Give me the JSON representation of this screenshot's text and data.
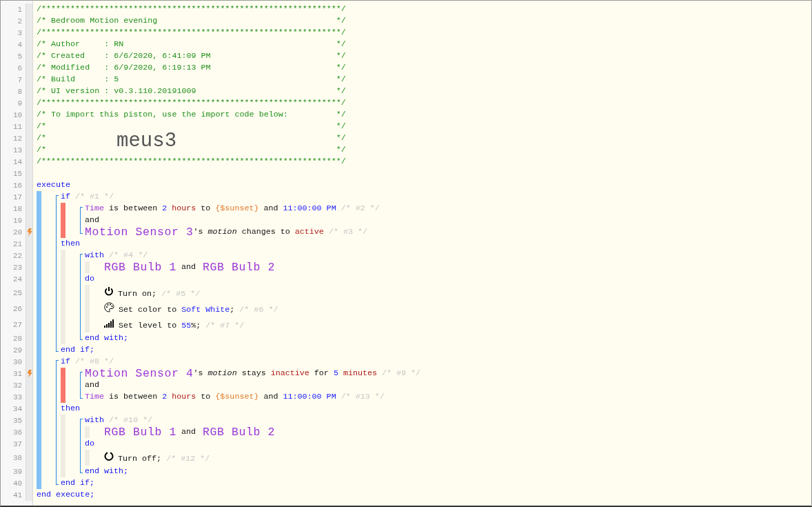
{
  "header": [
    {
      "number": "1",
      "kind": "rule",
      "text": "/**************************************************************/"
    },
    {
      "number": "2",
      "kind": "comment",
      "text": "/* Bedroom Motion evening",
      "end": "*/"
    },
    {
      "number": "3",
      "kind": "rule",
      "text": "/**************************************************************/"
    },
    {
      "number": "4",
      "kind": "comment",
      "text": "/* Author     : RN",
      "end": "*/"
    },
    {
      "number": "5",
      "kind": "comment",
      "text": "/* Created    : 6/6/2020, 6:41:09 PM",
      "end": "*/"
    },
    {
      "number": "6",
      "kind": "comment",
      "text": "/* Modified   : 6/9/2020, 6:19:13 PM",
      "end": "*/"
    },
    {
      "number": "7",
      "kind": "comment",
      "text": "/* Build      : 5",
      "end": "*/"
    },
    {
      "number": "8",
      "kind": "comment",
      "text": "/* UI version : v0.3.110.20191009",
      "end": "*/"
    },
    {
      "number": "9",
      "kind": "rule",
      "text": "/**************************************************************/"
    },
    {
      "number": "10",
      "kind": "comment",
      "text": "/* To import this piston, use the import code below:",
      "end": "*/"
    },
    {
      "number": "11",
      "kind": "comment",
      "text": "/*",
      "end": "*/"
    },
    {
      "number": "12",
      "kind": "code",
      "text": "/*",
      "code": "meus3",
      "end": "*/"
    },
    {
      "number": "13",
      "kind": "comment",
      "text": "/*",
      "end": "*/"
    },
    {
      "number": "14",
      "kind": "rule",
      "text": "/**************************************************************/"
    }
  ],
  "program": [
    {
      "number": "15"
    },
    {
      "number": "16",
      "tokens": [
        {
          "kind": "keyword",
          "text": "execute"
        }
      ]
    },
    {
      "kind": "block",
      "color": "#82bff7",
      "children": [
        {
          "kind": "statement",
          "children": [
            {
              "number": "17",
              "tokens": [
                {
                  "kind": "keyword",
                  "text": "if"
                },
                {
                  "kind": "comment",
                  "text": "/* #1 */"
                }
              ]
            },
            {
              "kind": "block",
              "color": "#f7776b",
              "children": [
                {
                  "kind": "statement",
                  "children": [
                    {
                      "number": "18",
                      "trigger": false,
                      "tokens": [
                        {
                          "kind": "attribute",
                          "text": "Time"
                        },
                        {
                          "kind": "plain",
                          "text": "is between"
                        },
                        {
                          "kind": "value",
                          "text": "2"
                        },
                        {
                          "kind": "unit",
                          "text": "hours"
                        },
                        {
                          "kind": "plain",
                          "text": "to"
                        },
                        {
                          "kind": "variable",
                          "text": "{$sunset}"
                        },
                        {
                          "kind": "plain",
                          "text": "and"
                        },
                        {
                          "kind": "value",
                          "text": "11:00:00 PM"
                        },
                        {
                          "kind": "comment",
                          "text": "/* #2 */"
                        }
                      ]
                    },
                    {
                      "number": "19",
                      "trigger": false,
                      "tokens": [
                        {
                          "kind": "plain",
                          "text": "and"
                        }
                      ]
                    },
                    {
                      "number": "20",
                      "trigger": true,
                      "tokens": [
                        {
                          "kind": "device",
                          "text": "Motion Sensor 3"
                        },
                        {
                          "kind": "suffix",
                          "text": "'s"
                        },
                        {
                          "kind": "italic",
                          "text": "motion"
                        },
                        {
                          "kind": "plain",
                          "text": "changes to"
                        },
                        {
                          "kind": "unit",
                          "text": "active"
                        },
                        {
                          "kind": "comment",
                          "text": "/* #3 */"
                        }
                      ]
                    }
                  ]
                }
              ]
            },
            {
              "number": "21",
              "tokens": [
                {
                  "kind": "keyword",
                  "text": "then"
                }
              ]
            },
            {
              "kind": "block",
              "color": "#efece2",
              "children": [
                {
                  "kind": "statement",
                  "children": [
                    {
                      "number": "22",
                      "tokens": [
                        {
                          "kind": "keyword",
                          "text": "with"
                        },
                        {
                          "kind": "comment",
                          "text": "/* #4 */"
                        }
                      ]
                    },
                    {
                      "kind": "block",
                      "color": "#efece2",
                      "children": [
                        {
                          "number": "23",
                          "tokens": [
                            {
                              "kind": "device",
                              "text": "RGB Bulb 1"
                            },
                            {
                              "kind": "plain",
                              "text": "and"
                            },
                            {
                              "kind": "device",
                              "text": "RGB Bulb 2"
                            }
                          ]
                        }
                      ]
                    },
                    {
                      "number": "24",
                      "tokens": [
                        {
                          "kind": "keyword",
                          "text": "do"
                        }
                      ]
                    },
                    {
                      "kind": "block",
                      "color": "#efece2",
                      "children": [
                        {
                          "number": "25",
                          "tokens": [
                            {
                              "kind": "power_icon"
                            },
                            {
                              "kind": "plain",
                              "text": "Turn on;"
                            },
                            {
                              "kind": "comment",
                              "text": "/* #5 */"
                            }
                          ]
                        },
                        {
                          "number": "26",
                          "tokens": [
                            {
                              "kind": "palette_icon"
                            },
                            {
                              "kind": "plain",
                              "text": "Set color to"
                            },
                            {
                              "kind": "value",
                              "text": "Soft White"
                            },
                            {
                              "kind": "suffix",
                              "text": ";"
                            },
                            {
                              "kind": "comment",
                              "text": "/* #6 */"
                            }
                          ]
                        },
                        {
                          "number": "27",
                          "tokens": [
                            {
                              "kind": "bars_icon"
                            },
                            {
                              "kind": "plain",
                              "text": "Set level to"
                            },
                            {
                              "kind": "value",
                              "text": "55"
                            },
                            {
                              "kind": "suffix",
                              "text": "%;"
                            },
                            {
                              "kind": "comment",
                              "text": "/* #7 */"
                            }
                          ]
                        }
                      ]
                    },
                    {
                      "number": "28",
                      "tokens": [
                        {
                          "kind": "keyword",
                          "text": "end with;"
                        }
                      ]
                    }
                  ]
                }
              ]
            },
            {
              "number": "29",
              "tokens": [
                {
                  "kind": "keyword",
                  "text": "end if;"
                }
              ]
            }
          ]
        },
        {
          "kind": "statement",
          "children": [
            {
              "number": "30",
              "tokens": [
                {
                  "kind": "keyword",
                  "text": "if"
                },
                {
                  "kind": "comment",
                  "text": "/* #8 */"
                }
              ]
            },
            {
              "kind": "block",
              "color": "#f7776b",
              "children": [
                {
                  "kind": "statement",
                  "children": [
                    {
                      "number": "31",
                      "trigger": true,
                      "tokens": [
                        {
                          "kind": "device",
                          "text": "Motion Sensor 4"
                        },
                        {
                          "kind": "suffix",
                          "text": "'s"
                        },
                        {
                          "kind": "italic",
                          "text": "motion"
                        },
                        {
                          "kind": "plain",
                          "text": "stays"
                        },
                        {
                          "kind": "unit",
                          "text": "inactive"
                        },
                        {
                          "kind": "plain",
                          "text": "for"
                        },
                        {
                          "kind": "value",
                          "text": "5"
                        },
                        {
                          "kind": "unit",
                          "text": "minutes"
                        },
                        {
                          "kind": "comment",
                          "text": "/* #9 */"
                        }
                      ]
                    },
                    {
                      "number": "32",
                      "trigger": false,
                      "tokens": [
                        {
                          "kind": "plain",
                          "text": "and"
                        }
                      ]
                    },
                    {
                      "number": "33",
                      "trigger": false,
                      "tokens": [
                        {
                          "kind": "attribute",
                          "text": "Time"
                        },
                        {
                          "kind": "plain",
                          "text": "is between"
                        },
                        {
                          "kind": "value",
                          "text": "2"
                        },
                        {
                          "kind": "unit",
                          "text": "hours"
                        },
                        {
                          "kind": "plain",
                          "text": "to"
                        },
                        {
                          "kind": "variable",
                          "text": "{$sunset}"
                        },
                        {
                          "kind": "plain",
                          "text": "and"
                        },
                        {
                          "kind": "value",
                          "text": "11:00:00 PM"
                        },
                        {
                          "kind": "comment",
                          "text": "/* #13 */"
                        }
                      ]
                    }
                  ]
                }
              ]
            },
            {
              "number": "34",
              "tokens": [
                {
                  "kind": "keyword",
                  "text": "then"
                }
              ]
            },
            {
              "kind": "block",
              "color": "#efece2",
              "children": [
                {
                  "kind": "statement",
                  "children": [
                    {
                      "number": "35",
                      "tokens": [
                        {
                          "kind": "keyword",
                          "text": "with"
                        },
                        {
                          "kind": "comment",
                          "text": "/* #10 */"
                        }
                      ]
                    },
                    {
                      "kind": "block",
                      "color": "#efece2",
                      "children": [
                        {
                          "number": "36",
                          "tokens": [
                            {
                              "kind": "device",
                              "text": "RGB Bulb 1"
                            },
                            {
                              "kind": "plain",
                              "text": "and"
                            },
                            {
                              "kind": "device",
                              "text": "RGB Bulb 2"
                            }
                          ]
                        }
                      ]
                    },
                    {
                      "number": "37",
                      "tokens": [
                        {
                          "kind": "keyword",
                          "text": "do"
                        }
                      ]
                    },
                    {
                      "kind": "block",
                      "color": "#efece2",
                      "children": [
                        {
                          "number": "38",
                          "tokens": [
                            {
                              "kind": "off_icon"
                            },
                            {
                              "kind": "plain",
                              "text": "Turn off;"
                            },
                            {
                              "kind": "comment",
                              "text": "/* #12 */"
                            }
                          ]
                        }
                      ]
                    },
                    {
                      "number": "39",
                      "tokens": [
                        {
                          "kind": "keyword",
                          "text": "end with;"
                        }
                      ]
                    }
                  ]
                }
              ]
            },
            {
              "number": "40",
              "tokens": [
                {
                  "kind": "keyword",
                  "text": "end if;"
                }
              ]
            }
          ]
        }
      ]
    },
    {
      "number": "41",
      "tokens": [
        {
          "kind": "keyword",
          "text": "end execute;"
        }
      ]
    }
  ]
}
